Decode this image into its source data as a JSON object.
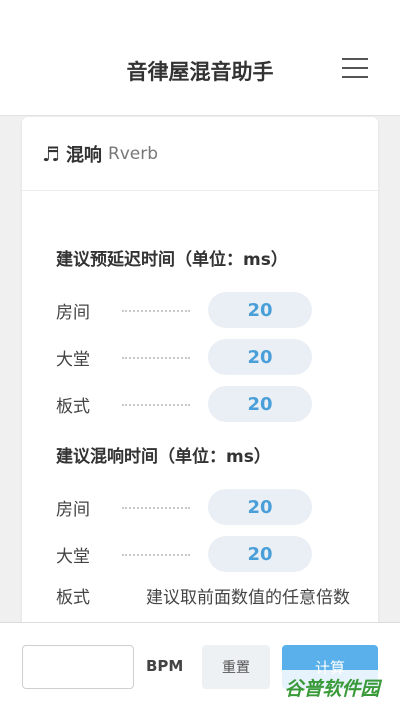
{
  "header": {
    "title": "音律屋混音助手",
    "menu_icon": "hamburger-menu-icon"
  },
  "card": {
    "icon": "music-note-icon",
    "title": "混响",
    "subtitle": "Rverb",
    "sections": [
      {
        "title": "建议预延迟时间（单位：ms）",
        "rows": [
          {
            "label": "房间",
            "value": "20"
          },
          {
            "label": "大堂",
            "value": "20"
          },
          {
            "label": "板式",
            "value": "20"
          }
        ]
      },
      {
        "title": "建议混响时间（单位：ms）",
        "rows": [
          {
            "label": "房间",
            "value": "20"
          },
          {
            "label": "大堂",
            "value": "20"
          }
        ]
      }
    ],
    "last_row": {
      "label": "板式",
      "note": "建议取前面数值的任意倍数"
    }
  },
  "bottom": {
    "bpm_value": "",
    "bpm_label": "BPM",
    "reset_label": "重置",
    "calc_label": "计算"
  },
  "watermark": "谷普软件园"
}
